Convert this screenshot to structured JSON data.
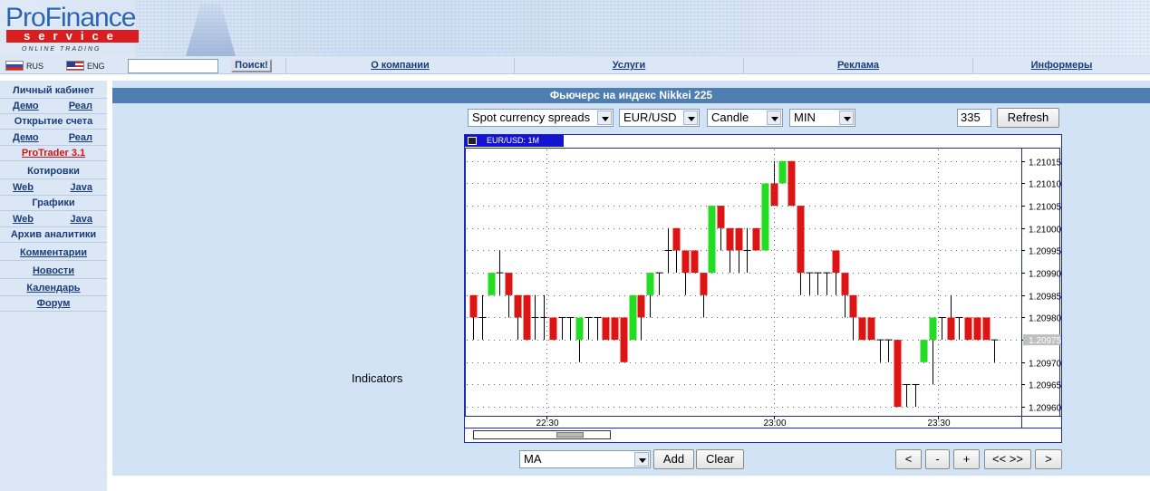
{
  "header": {
    "logo_top": "ProFinance",
    "logo_bottom": "service",
    "logo_tagline": "ONLINE TRADING"
  },
  "navbar": {
    "lang_ru": "RUS",
    "lang_en": "ENG",
    "search_value": "",
    "search_button": "Поиск!",
    "links": [
      "О компании",
      "Услуги",
      "Реклама",
      "Информеры"
    ]
  },
  "sidebar": {
    "cabinet": "Личный кабинет",
    "cabinet_demo": "Демо",
    "cabinet_real": "Реал",
    "account": "Открытие счета",
    "account_demo": "Демо",
    "account_real": "Реал",
    "protrader": "ProTrader 3.1",
    "quotes": "Котировки",
    "quotes_web": "Web",
    "quotes_java": "Java",
    "charts": "Графики",
    "charts_web": "Web",
    "charts_java": "Java",
    "archive": "Архив аналитики",
    "comments": "Комментарии",
    "news": "Новости",
    "calendar": "Календарь",
    "forum": "Форум"
  },
  "main": {
    "title": "Фьючерс на индекс Nikkei 225",
    "source_select": "Spot currency spreads",
    "symbol_select": "EUR/USD",
    "type_select": "Candle",
    "interval_select": "MIN",
    "count_value": "335",
    "refresh": "Refresh",
    "indicators_label": "Indicators",
    "indicator_select": "MA",
    "add": "Add",
    "clear": "Clear",
    "nav_buttons": [
      "<",
      "-",
      "+",
      "<< >>",
      ">"
    ]
  },
  "chart_data": {
    "type": "candlestick",
    "caption": "EUR/USD: 1M",
    "x_ticks": [
      "22:30",
      "23:00",
      "23:30"
    ],
    "y_ticks": [
      "1.21015",
      "1.21010",
      "1.21005",
      "1.21000",
      "1.20995",
      "1.20990",
      "1.20985",
      "1.20980",
      "1.20975",
      "1.20970",
      "1.20965",
      "1.20960"
    ],
    "current_price": "1.20975",
    "ylim": [
      1.20958,
      1.21018
    ],
    "grid": true,
    "colors": {
      "up": "#22dd22",
      "down": "#dd1414",
      "frame": "#1b2ab0",
      "price_tag": "#bfbfbf"
    },
    "candles": [
      [
        1.20985,
        1.2098,
        1.20985,
        1.20975
      ],
      [
        1.2098,
        1.2098,
        1.20985,
        1.20975
      ],
      [
        1.20985,
        1.2099,
        1.2099,
        1.20985
      ],
      [
        1.2099,
        1.2099,
        1.20995,
        1.20985
      ],
      [
        1.2099,
        1.20985,
        1.2099,
        1.2098
      ],
      [
        1.20985,
        1.2098,
        1.20985,
        1.20975
      ],
      [
        1.20985,
        1.20975,
        1.20985,
        1.20975
      ],
      [
        1.2098,
        1.2098,
        1.20985,
        1.20975
      ],
      [
        1.2098,
        1.2098,
        1.20985,
        1.20975
      ],
      [
        1.2098,
        1.20975,
        1.2098,
        1.20975
      ],
      [
        1.2098,
        1.2098,
        1.2098,
        1.20975
      ],
      [
        1.2098,
        1.2098,
        1.2098,
        1.20975
      ],
      [
        1.20975,
        1.2098,
        1.2098,
        1.2097
      ],
      [
        1.2098,
        1.2098,
        1.2098,
        1.20975
      ],
      [
        1.2098,
        1.2098,
        1.2098,
        1.20975
      ],
      [
        1.2098,
        1.20975,
        1.2098,
        1.20975
      ],
      [
        1.2098,
        1.20975,
        1.2098,
        1.20975
      ],
      [
        1.2098,
        1.2097,
        1.2098,
        1.2097
      ],
      [
        1.20975,
        1.20985,
        1.20985,
        1.20975
      ],
      [
        1.20985,
        1.2098,
        1.20985,
        1.20975
      ],
      [
        1.20985,
        1.2099,
        1.2099,
        1.2098
      ],
      [
        1.2099,
        1.2099,
        1.2099,
        1.20985
      ],
      [
        1.20995,
        1.20995,
        1.21,
        1.2099
      ],
      [
        1.21,
        1.20995,
        1.21,
        1.2099
      ],
      [
        1.20995,
        1.2099,
        1.20995,
        1.20985
      ],
      [
        1.20995,
        1.2099,
        1.20995,
        1.2099
      ],
      [
        1.2099,
        1.20985,
        1.2099,
        1.2098
      ],
      [
        1.2099,
        1.21005,
        1.21005,
        1.2099
      ],
      [
        1.21005,
        1.21,
        1.21005,
        1.20995
      ],
      [
        1.21,
        1.20995,
        1.21,
        1.2099
      ],
      [
        1.21,
        1.20995,
        1.21,
        1.2099
      ],
      [
        1.20995,
        1.20995,
        1.21,
        1.2099
      ],
      [
        1.21,
        1.20995,
        1.21,
        1.20995
      ],
      [
        1.20995,
        1.2101,
        1.2101,
        1.20995
      ],
      [
        1.2101,
        1.21005,
        1.21015,
        1.21005
      ],
      [
        1.2101,
        1.21015,
        1.21015,
        1.2101
      ],
      [
        1.21015,
        1.21005,
        1.21015,
        1.21005
      ],
      [
        1.21005,
        1.2099,
        1.21005,
        1.20985
      ],
      [
        1.2099,
        1.2099,
        1.2099,
        1.20985
      ],
      [
        1.2099,
        1.2099,
        1.2099,
        1.20985
      ],
      [
        1.2099,
        1.2099,
        1.2099,
        1.20985
      ],
      [
        1.20995,
        1.2099,
        1.20995,
        1.20985
      ],
      [
        1.2099,
        1.20985,
        1.2099,
        1.2098
      ],
      [
        1.20985,
        1.2098,
        1.20985,
        1.20975
      ],
      [
        1.2098,
        1.20975,
        1.2098,
        1.20975
      ],
      [
        1.2098,
        1.20975,
        1.2098,
        1.20975
      ],
      [
        1.20975,
        1.20975,
        1.20975,
        1.2097
      ],
      [
        1.20975,
        1.20975,
        1.20975,
        1.2097
      ],
      [
        1.20975,
        1.2096,
        1.20975,
        1.2096
      ],
      [
        1.20965,
        1.20965,
        1.20965,
        1.2096
      ],
      [
        1.20965,
        1.20965,
        1.20965,
        1.2096
      ],
      [
        1.2097,
        1.20975,
        1.20975,
        1.2097
      ],
      [
        1.20975,
        1.2098,
        1.2098,
        1.20965
      ],
      [
        1.2098,
        1.2098,
        1.2098,
        1.20975
      ],
      [
        1.2098,
        1.20975,
        1.20985,
        1.20975
      ],
      [
        1.2098,
        1.2098,
        1.2098,
        1.20975
      ],
      [
        1.2098,
        1.20975,
        1.2098,
        1.20975
      ],
      [
        1.2098,
        1.20975,
        1.2098,
        1.20975
      ],
      [
        1.2098,
        1.20975,
        1.2098,
        1.20975
      ],
      [
        1.20975,
        1.20975,
        1.20975,
        1.2097
      ]
    ]
  }
}
